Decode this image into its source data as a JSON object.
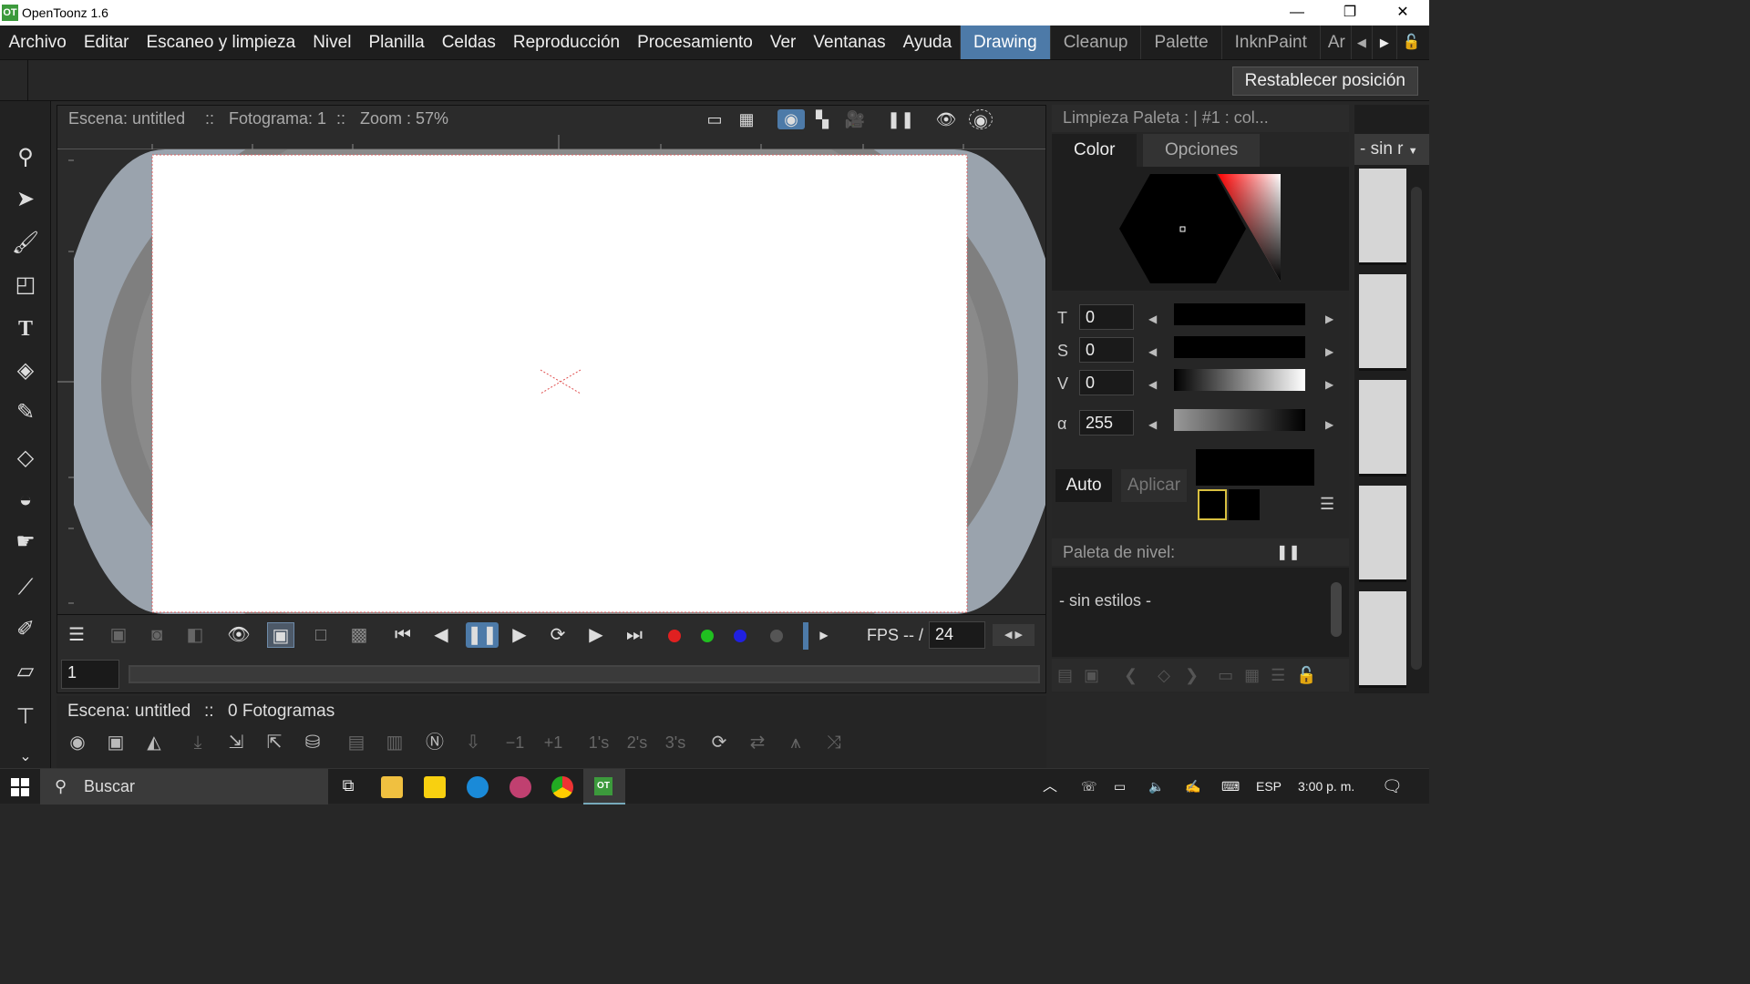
{
  "app": {
    "title": "OpenToonz 1.6",
    "logo": "OT"
  },
  "window": {
    "minimize": "—",
    "restore": "❐",
    "close": "✕"
  },
  "menu": [
    "Archivo",
    "Editar",
    "Escaneo y limpieza",
    "Nivel",
    "Planilla",
    "Celdas",
    "Reproducción",
    "Procesamiento",
    "Ver",
    "Ventanas",
    "Ayuda"
  ],
  "rooms": {
    "items": [
      "Drawing",
      "Cleanup",
      "Palette",
      "InknPaint",
      "Ar"
    ],
    "active": "Drawing"
  },
  "toprow": {
    "reset_label": "Restablecer posición"
  },
  "viewer": {
    "scene_label": "Escena: untitled",
    "frame_label": "Fotograma: 1",
    "zoom_label": "Zoom : 57%",
    "sep": "::",
    "fps_label": "FPS -- /",
    "fps_value": "24",
    "frame_field": "1"
  },
  "palette": {
    "title": "Limpieza Paleta :  | #1 : col...",
    "tab_color": "Color",
    "tab_options": "Opciones",
    "h_label": "T",
    "h_value": "0",
    "s_label": "S",
    "s_value": "0",
    "v_label": "V",
    "v_value": "0",
    "alpha_label": "α",
    "alpha_value": "255",
    "auto_label": "Auto",
    "apply_label": "Aplicar",
    "level_palette_label": "Paleta de nivel:",
    "no_styles": "- sin estilos -",
    "current_color": "#000000"
  },
  "strip": {
    "header": "- sin r"
  },
  "xsheet": {
    "scene_label": "Escena: untitled",
    "sep": "::",
    "frames_label": "0 Fotogramas"
  },
  "taskbar": {
    "search_placeholder": "Buscar",
    "lang": "ESP",
    "time": "3:00 p. m."
  },
  "colors": {
    "accent": "#4d7aa8",
    "bg": "#272727",
    "canvas_border": "#b0b8c2"
  }
}
